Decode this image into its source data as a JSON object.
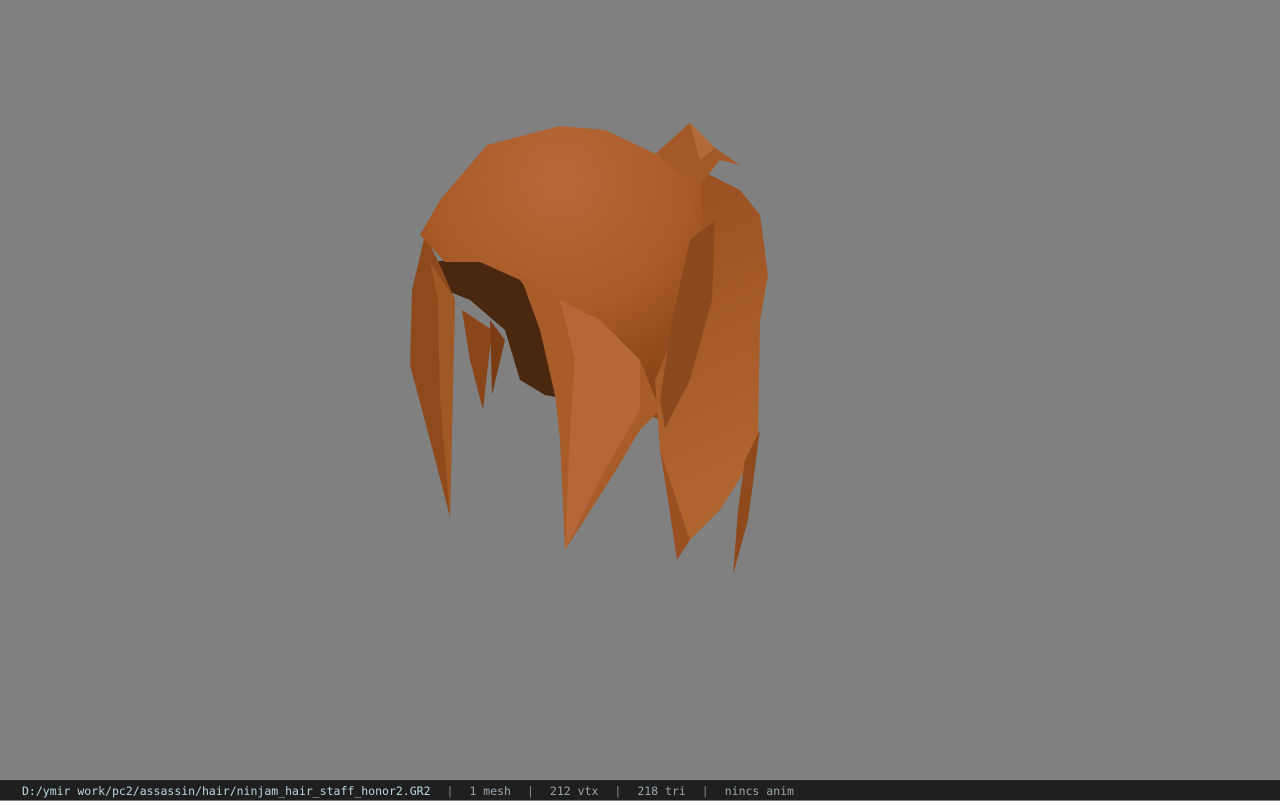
{
  "viewer": {
    "background_color": "#808080",
    "model_color": "#b0642e",
    "model_description": "hair mesh"
  },
  "status": {
    "file_path": "D:/ymir work/pc2/assassin/hair/ninjam_hair_staff_honor2.GR2",
    "separator": "|",
    "mesh_count": "1 mesh",
    "vertex_count": "212 vtx",
    "triangle_count": "218 tri",
    "anim_status": "nincs anim"
  }
}
